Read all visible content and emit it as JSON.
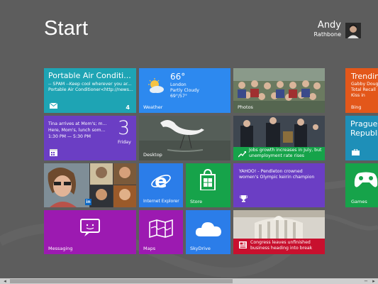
{
  "header": {
    "title": "Start"
  },
  "user": {
    "first_name": "Andy",
    "last_name": "Rathbone"
  },
  "tiles": {
    "portable_air": {
      "title": "Portable Air Conditi...",
      "line1": "-- SPAM --Keep cool wherever you ar...",
      "line2": "Portable Air Conditioner<http://news...",
      "count": "4",
      "color": "#1ea4b4"
    },
    "weather": {
      "temp": "66°",
      "city": "London",
      "condition": "Partly Cloudy",
      "range": "69°/57°",
      "label": "Weather",
      "color": "#2d89ef"
    },
    "photos": {
      "label": "Photos"
    },
    "trending": {
      "title": "Trending",
      "line1": "Gabby Douglas",
      "line2": "Total Recall",
      "line3": "Kiss in",
      "label": "Bing",
      "color": "#e3571a"
    },
    "calendar": {
      "line1": "Tina arrives at Mom's; m...",
      "line2": "Here, Mom's, lunch som...",
      "line3": "1:30 PM — 5:30 PM",
      "day_number": "3",
      "day_name": "Friday",
      "color": "#6b3ec4"
    },
    "desktop": {
      "label": "Desktop"
    },
    "finance": {
      "headline": "Jobs growth increases in July, but unemployment rate rises",
      "color": "#16a34a"
    },
    "travel": {
      "title": "Prague,",
      "subtitle": "Republic",
      "color": "#1e8fb8"
    },
    "ie": {
      "label": "Internet Explorer",
      "color": "#2b7de9"
    },
    "store": {
      "label": "Store",
      "color": "#16a34a"
    },
    "sports": {
      "headline": "YAHOO! - Pendleton crowned women's Olympic keirin champion",
      "color": "#6b3ec4"
    },
    "games": {
      "label": "Games",
      "color": "#16a34a"
    },
    "messaging": {
      "label": "Messaging",
      "color": "#9c1ab1"
    },
    "maps": {
      "label": "Maps",
      "color": "#9c1ab1"
    },
    "skydrive": {
      "label": "SkyDrive",
      "color": "#2b7de9"
    },
    "news": {
      "headline": "Congress leaves unfinished business heading into break",
      "color": "#c8102e"
    }
  },
  "icons": {
    "mail": "mail-icon",
    "sun": "sun-cloud-icon",
    "calendar": "calendar-icon",
    "finance": "chart-up-icon",
    "trophy": "trophy-icon",
    "linkedin": "linkedin-icon",
    "news": "newspaper-icon",
    "suitcase": "suitcase-icon"
  }
}
